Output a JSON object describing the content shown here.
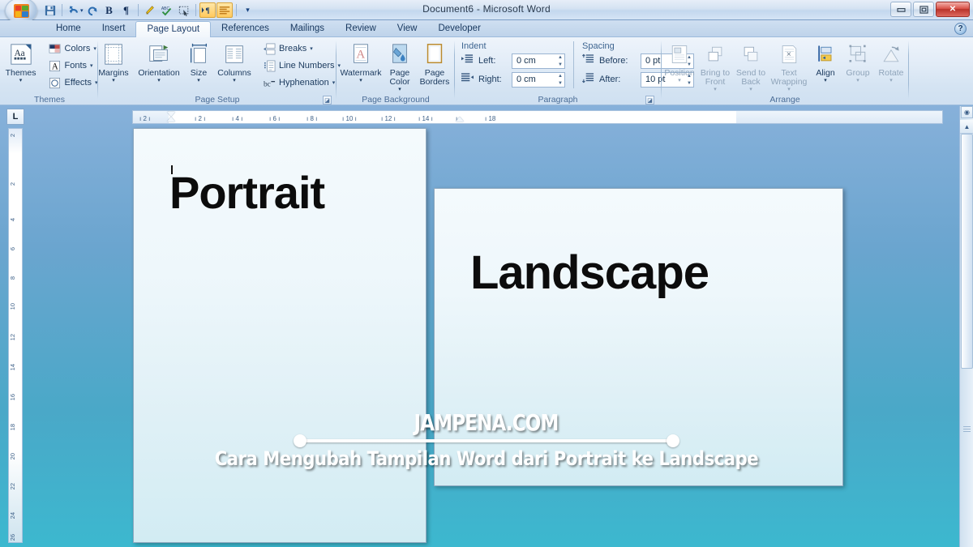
{
  "window": {
    "title": "Document6 - Microsoft Word",
    "buttons": {
      "minimize": "—",
      "restore": "❐",
      "close": "✕"
    },
    "office_button": "office-orb"
  },
  "quick_access": [
    {
      "name": "save-icon",
      "glyph": "💾"
    },
    {
      "name": "undo-icon",
      "glyph": "↰"
    },
    {
      "name": "redo-icon",
      "glyph": "↻"
    },
    {
      "name": "bold-icon",
      "glyph": "B"
    },
    {
      "name": "show-formatting-marks-icon",
      "glyph": "¶"
    },
    {
      "name": "format-painter-icon",
      "glyph": "✐"
    },
    {
      "name": "spelling-grammar-icon",
      "glyph": "ABC"
    },
    {
      "name": "select-objects-icon",
      "glyph": "⬚"
    },
    {
      "name": "rtl-text-direction-icon",
      "glyph": "▸¶"
    },
    {
      "name": "ltr-text-direction-icon",
      "glyph": "≡"
    },
    {
      "name": "customize-qat-icon",
      "glyph": "▾"
    }
  ],
  "tabs": [
    {
      "label": "Home",
      "active": false
    },
    {
      "label": "Insert",
      "active": false
    },
    {
      "label": "Page Layout",
      "active": true
    },
    {
      "label": "References",
      "active": false
    },
    {
      "label": "Mailings",
      "active": false
    },
    {
      "label": "Review",
      "active": false
    },
    {
      "label": "View",
      "active": false
    },
    {
      "label": "Developer",
      "active": false
    }
  ],
  "help_button": "?",
  "ribbon": {
    "groups": {
      "themes": {
        "label": "Themes",
        "big": {
          "label": "Themes",
          "caret": "▾"
        },
        "small": [
          {
            "label": "Colors",
            "caret": "▾"
          },
          {
            "label": "Fonts",
            "caret": "▾"
          },
          {
            "label": "Effects",
            "caret": "▾"
          }
        ]
      },
      "page_setup": {
        "label": "Page Setup",
        "big": [
          {
            "label": "Margins",
            "caret": "▾"
          },
          {
            "label": "Orientation",
            "caret": "▾"
          },
          {
            "label": "Size",
            "caret": "▾"
          },
          {
            "label": "Columns",
            "caret": "▾"
          }
        ],
        "small": [
          {
            "label": "Breaks",
            "caret": "▾"
          },
          {
            "label": "Line Numbers",
            "caret": "▾"
          },
          {
            "label": "Hyphenation",
            "caret": "▾"
          }
        ],
        "launcher": "◪"
      },
      "page_background": {
        "label": "Page Background",
        "big": [
          {
            "label": "Watermark",
            "caret": "▾"
          },
          {
            "label": "Page Color",
            "caret": "▾"
          },
          {
            "label": "Page Borders",
            "caret": ""
          }
        ]
      },
      "paragraph": {
        "label": "Paragraph",
        "indent_head": "Indent",
        "spacing_head": "Spacing",
        "fields": [
          {
            "label": "Left:",
            "value": "0 cm"
          },
          {
            "label": "Right:",
            "value": "0 cm"
          },
          {
            "label": "Before:",
            "value": "0 pt"
          },
          {
            "label": "After:",
            "value": "10 pt"
          }
        ],
        "launcher": "◪"
      },
      "arrange": {
        "label": "Arrange",
        "big": [
          {
            "label": "Position",
            "caret": "▾",
            "dim": true
          },
          {
            "label": "Bring to Front",
            "caret": "▾",
            "dim": true
          },
          {
            "label": "Send to Back",
            "caret": "▾",
            "dim": true
          },
          {
            "label": "Text Wrapping",
            "caret": "▾",
            "dim": true
          },
          {
            "label": "Align",
            "caret": "▾",
            "dim": false
          },
          {
            "label": "Group",
            "caret": "▾",
            "dim": true
          },
          {
            "label": "Rotate",
            "caret": "▾",
            "dim": true
          }
        ]
      }
    }
  },
  "rulers": {
    "corner_tab_stop": "L",
    "horizontal_ticks": [
      "2",
      "2",
      "4",
      "6",
      "8",
      "10",
      "12",
      "14",
      "18"
    ],
    "vertical_ticks": [
      "2",
      "2",
      "4",
      "6",
      "8",
      "10",
      "12",
      "14",
      "16",
      "18",
      "20",
      "22",
      "24",
      "26"
    ]
  },
  "document": {
    "portrait_page_text": "Portrait",
    "landscape_page_text": "Landscape"
  },
  "watermark": {
    "site": "JAMPENA.COM",
    "caption": "Cara Mengubah Tampilan Word dari Portrait ke Landscape"
  },
  "scrollbar": {
    "up_arrow": "▲",
    "down_arrow": "▼",
    "previous_page": "▲",
    "next_page": "▼",
    "select_browse_object": "◉"
  },
  "colors": {
    "accent": "#1f3f6b",
    "ribbon_bg": "#e2ecf7",
    "desktop_top": "#a8c2e0",
    "desktop_bottom": "#3cb8cf",
    "close_button": "#b8332b",
    "qat_active": "#ffc95e"
  }
}
